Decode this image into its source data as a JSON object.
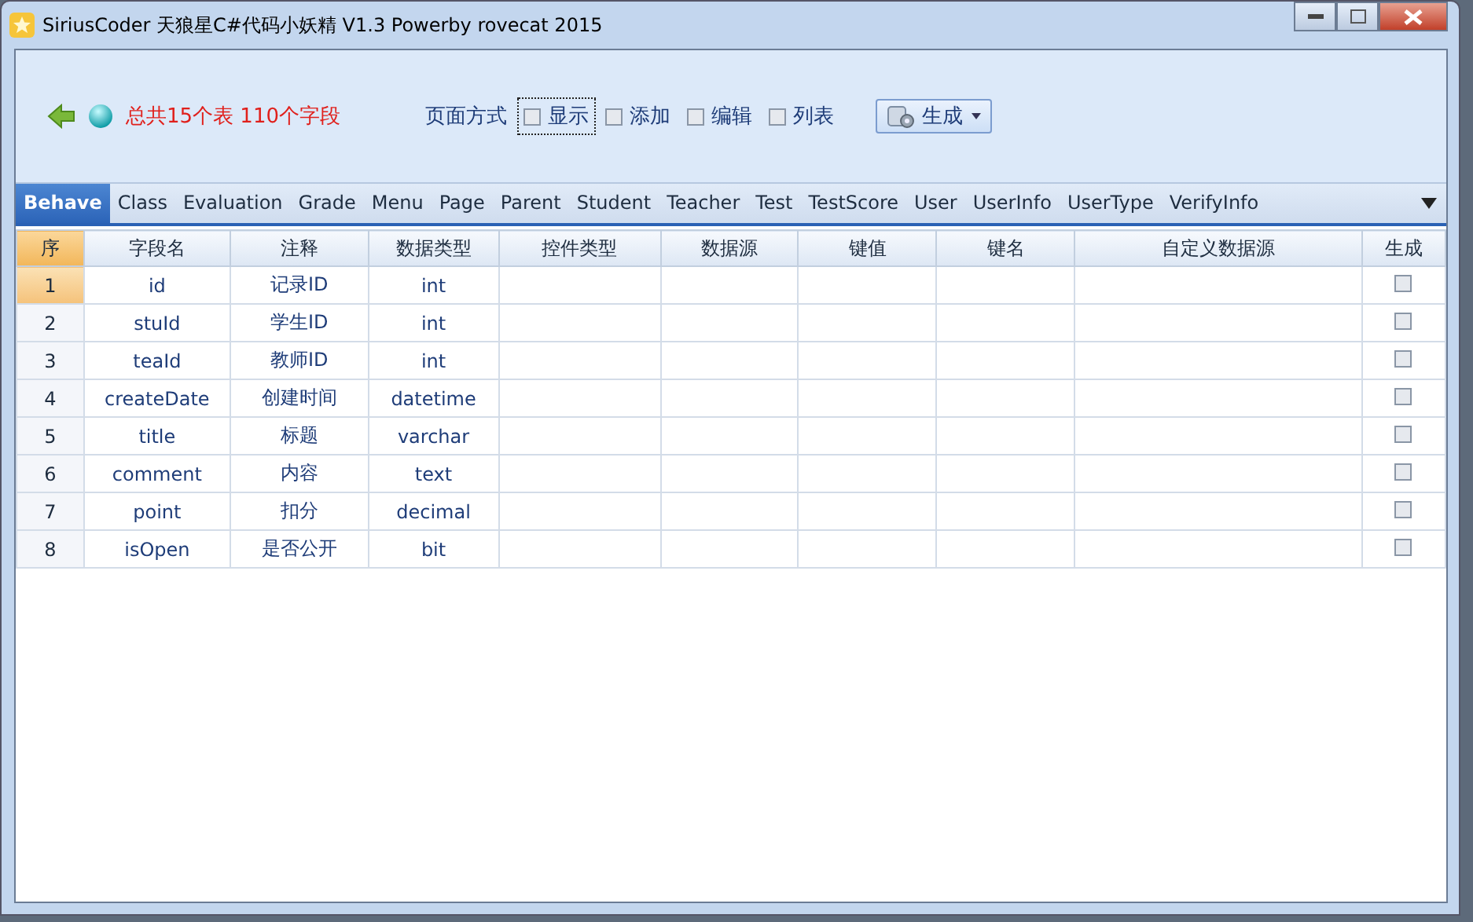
{
  "window": {
    "title": "SiriusCoder 天狼星C#代码小妖精  V1.3  Powerby rovecat  2015"
  },
  "toolbar": {
    "summary": "总共15个表 110个字段",
    "page_mode_label": "页面方式",
    "options": [
      {
        "label": "显示",
        "checked": false,
        "focused": true
      },
      {
        "label": "添加",
        "checked": false,
        "focused": false
      },
      {
        "label": "编辑",
        "checked": false,
        "focused": false
      },
      {
        "label": "列表",
        "checked": false,
        "focused": false
      }
    ],
    "generate_button": "生成"
  },
  "tabs": [
    {
      "label": "Behave",
      "selected": true
    },
    {
      "label": "Class",
      "selected": false
    },
    {
      "label": "Evaluation",
      "selected": false
    },
    {
      "label": "Grade",
      "selected": false
    },
    {
      "label": "Menu",
      "selected": false
    },
    {
      "label": "Page",
      "selected": false
    },
    {
      "label": "Parent",
      "selected": false
    },
    {
      "label": "Student",
      "selected": false
    },
    {
      "label": "Teacher",
      "selected": false
    },
    {
      "label": "Test",
      "selected": false
    },
    {
      "label": "TestScore",
      "selected": false
    },
    {
      "label": "User",
      "selected": false
    },
    {
      "label": "UserInfo",
      "selected": false
    },
    {
      "label": "UserType",
      "selected": false
    },
    {
      "label": "VerifyInfo",
      "selected": false
    }
  ],
  "table": {
    "columns": [
      "序",
      "字段名",
      "注释",
      "数据类型",
      "控件类型",
      "数据源",
      "键值",
      "键名",
      "自定义数据源",
      "生成"
    ],
    "rows": [
      {
        "no": "1",
        "field": "id",
        "comment": "记录ID",
        "type": "int",
        "generate": false,
        "selected": true
      },
      {
        "no": "2",
        "field": "stuId",
        "comment": "学生ID",
        "type": "int",
        "generate": false,
        "selected": false
      },
      {
        "no": "3",
        "field": "teaId",
        "comment": "教师ID",
        "type": "int",
        "generate": false,
        "selected": false
      },
      {
        "no": "4",
        "field": "createDate",
        "comment": "创建时间",
        "type": "datetime",
        "generate": false,
        "selected": false
      },
      {
        "no": "5",
        "field": "title",
        "comment": "标题",
        "type": "varchar",
        "generate": false,
        "selected": false
      },
      {
        "no": "6",
        "field": "comment",
        "comment": "内容",
        "type": "text",
        "generate": false,
        "selected": false
      },
      {
        "no": "7",
        "field": "point",
        "comment": "扣分",
        "type": "decimal",
        "generate": false,
        "selected": false
      },
      {
        "no": "8",
        "field": "isOpen",
        "comment": "是否公开",
        "type": "bit",
        "generate": false,
        "selected": false
      }
    ]
  }
}
